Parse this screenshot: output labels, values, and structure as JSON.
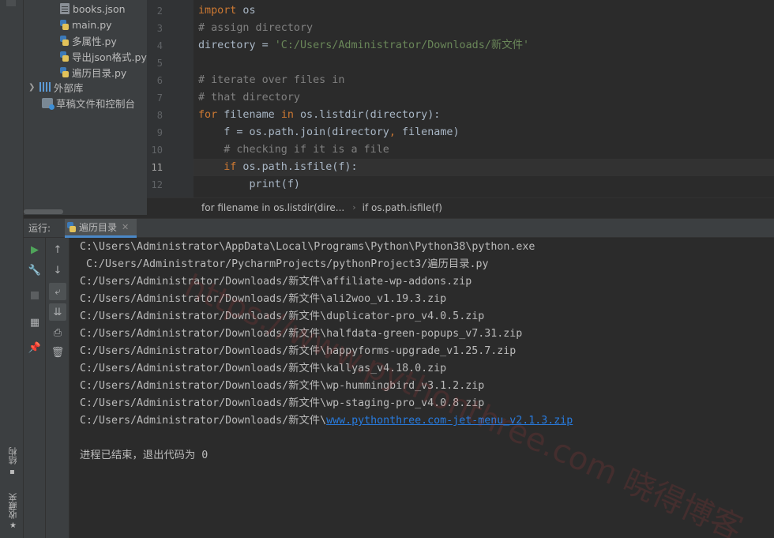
{
  "side_strip": {
    "structure_label": "结构",
    "favorites_label": "收藏夹"
  },
  "project_tree": {
    "items": [
      {
        "label": "books.json",
        "icon": "json-file-icon"
      },
      {
        "label": "main.py",
        "icon": "python-file-icon"
      },
      {
        "label": "多属性.py",
        "icon": "python-file-icon"
      },
      {
        "label": "导出json格式.py",
        "icon": "python-file-icon"
      },
      {
        "label": "遍历目录.py",
        "icon": "python-file-icon"
      }
    ],
    "external_libraries": "外部库",
    "scratches": "草稿文件和控制台"
  },
  "editor": {
    "line_numbers": [
      "2",
      "3",
      "4",
      "5",
      "6",
      "7",
      "8",
      "9",
      "10",
      "11",
      "12"
    ],
    "lines": {
      "l2_kw": "import",
      "l2_rest": " os",
      "l3": "# assign directory",
      "l4_a": "directory = ",
      "l4_str": "'C:/Users/Administrator/Downloads/新文件'",
      "l6": "# iterate over files in",
      "l7": "# that directory",
      "l8_for": "for",
      "l8_a": " filename ",
      "l8_in": "in",
      "l8_b": " os.listdir(directory):",
      "l9_a": "    f = os.path.join(directory",
      "l9_comma": ",",
      "l9_b": " filename)",
      "l10": "    # checking if it is a file",
      "l11_if": "    if",
      "l11_b": " os.path.isfile(f):",
      "l12": "        print(f)"
    },
    "breadcrumb": [
      "for filename in os.listdir(dire...",
      "if os.path.isfile(f)"
    ]
  },
  "run": {
    "label": "运行:",
    "tab_label": "遍历目录",
    "output": [
      "C:\\Users\\Administrator\\AppData\\Local\\Programs\\Python\\Python38\\python.exe",
      " C:/Users/Administrator/PycharmProjects/pythonProject3/遍历目录.py",
      "C:/Users/Administrator/Downloads/新文件\\affiliate-wp-addons.zip",
      "C:/Users/Administrator/Downloads/新文件\\ali2woo_v1.19.3.zip",
      "C:/Users/Administrator/Downloads/新文件\\duplicator-pro_v4.0.5.zip",
      "C:/Users/Administrator/Downloads/新文件\\halfdata-green-popups_v7.31.zip",
      "C:/Users/Administrator/Downloads/新文件\\happyforms-upgrade_v1.25.7.zip",
      "C:/Users/Administrator/Downloads/新文件\\kallyas_v4.18.0.zip",
      "C:/Users/Administrator/Downloads/新文件\\wp-hummingbird_v3.1.2.zip",
      "C:/Users/Administrator/Downloads/新文件\\wp-staging-pro_v4.0.8.zip"
    ],
    "last_prefix": "C:/Users/Administrator/Downloads/新文件\\",
    "last_link": "www.pythonthree.com-jet-menu_v2.1.3.zip",
    "exit_message": "进程已结束，退出代码为 0"
  },
  "watermark": "https://www.pythonthree.com 晓得博客",
  "colors": {
    "keyword": "#cc7832",
    "comment": "#808080",
    "string": "#6a8759",
    "link": "#287bde",
    "run_green": "#4fa55a"
  }
}
